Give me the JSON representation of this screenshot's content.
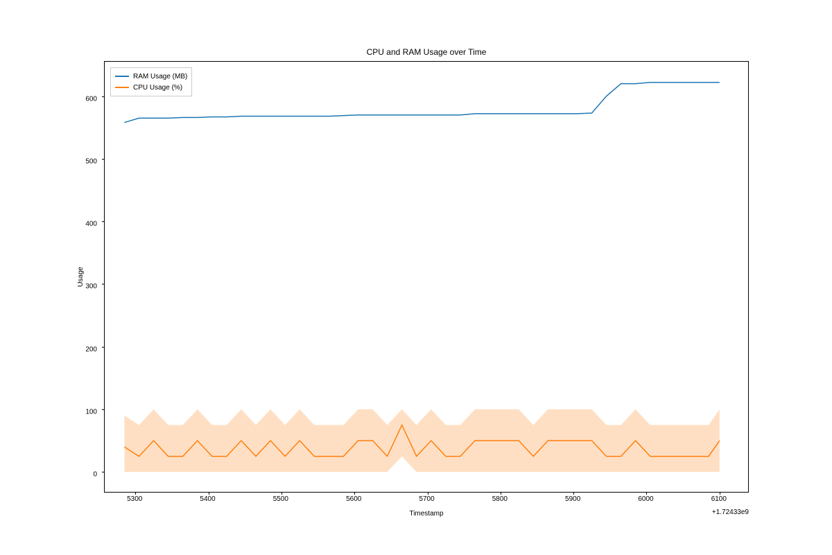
{
  "chart_data": {
    "type": "line",
    "title": "CPU and RAM Usage over Time",
    "xlabel": "Timestamp",
    "ylabel": "Usage",
    "x_offset_text": "+1.72433e9",
    "xlim": [
      5258,
      6141
    ],
    "ylim": [
      -34,
      655
    ],
    "xticks": [
      5300,
      5400,
      5500,
      5600,
      5700,
      5800,
      5900,
      6000,
      6100
    ],
    "yticks": [
      0,
      100,
      200,
      300,
      400,
      500,
      600
    ],
    "legend_position": "upper left",
    "series": [
      {
        "name": "RAM Usage (MB)",
        "color": "#1f77b4",
        "x": [
          5285,
          5305,
          5325,
          5345,
          5365,
          5385,
          5405,
          5425,
          5445,
          5465,
          5485,
          5505,
          5525,
          5545,
          5565,
          5585,
          5605,
          5625,
          5645,
          5665,
          5685,
          5705,
          5725,
          5745,
          5765,
          5785,
          5805,
          5825,
          5845,
          5865,
          5885,
          5905,
          5925,
          5945,
          5965,
          5985,
          6005,
          6025,
          6045,
          6065,
          6085,
          6100
        ],
        "values": [
          558,
          565,
          565,
          565,
          566,
          566,
          567,
          567,
          568,
          568,
          568,
          568,
          568,
          568,
          568,
          569,
          570,
          570,
          570,
          570,
          570,
          570,
          570,
          570,
          572,
          572,
          572,
          572,
          572,
          572,
          572,
          572,
          573,
          600,
          620,
          620,
          622,
          622,
          622,
          622,
          622,
          622
        ]
      },
      {
        "name": "CPU Usage (%)",
        "color": "#ff7f0e",
        "x": [
          5285,
          5305,
          5325,
          5345,
          5365,
          5385,
          5405,
          5425,
          5445,
          5465,
          5485,
          5505,
          5525,
          5545,
          5565,
          5585,
          5605,
          5625,
          5645,
          5665,
          5685,
          5705,
          5725,
          5745,
          5765,
          5785,
          5805,
          5825,
          5845,
          5865,
          5885,
          5905,
          5925,
          5945,
          5965,
          5985,
          6005,
          6025,
          6045,
          6065,
          6085,
          6100
        ],
        "values": [
          40,
          25,
          50,
          25,
          25,
          50,
          25,
          25,
          50,
          25,
          50,
          25,
          50,
          25,
          25,
          25,
          50,
          50,
          25,
          75,
          25,
          50,
          25,
          25,
          50,
          50,
          50,
          50,
          25,
          50,
          50,
          50,
          50,
          25,
          25,
          50,
          25,
          25,
          25,
          25,
          25,
          50
        ],
        "fill_upper": [
          90,
          75,
          100,
          75,
          75,
          100,
          75,
          75,
          100,
          75,
          100,
          75,
          100,
          75,
          75,
          75,
          100,
          100,
          75,
          100,
          75,
          100,
          75,
          75,
          100,
          100,
          100,
          100,
          75,
          100,
          100,
          100,
          100,
          75,
          75,
          100,
          75,
          75,
          75,
          75,
          75,
          100
        ],
        "fill_lower": [
          0,
          0,
          0,
          0,
          0,
          0,
          0,
          0,
          0,
          0,
          0,
          0,
          0,
          0,
          0,
          0,
          0,
          0,
          0,
          25,
          0,
          0,
          0,
          0,
          0,
          0,
          0,
          0,
          0,
          0,
          0,
          0,
          0,
          0,
          0,
          0,
          0,
          0,
          0,
          0,
          0,
          0
        ],
        "fill_color": "#ff7f0e",
        "fill_alpha": 0.25
      }
    ]
  }
}
